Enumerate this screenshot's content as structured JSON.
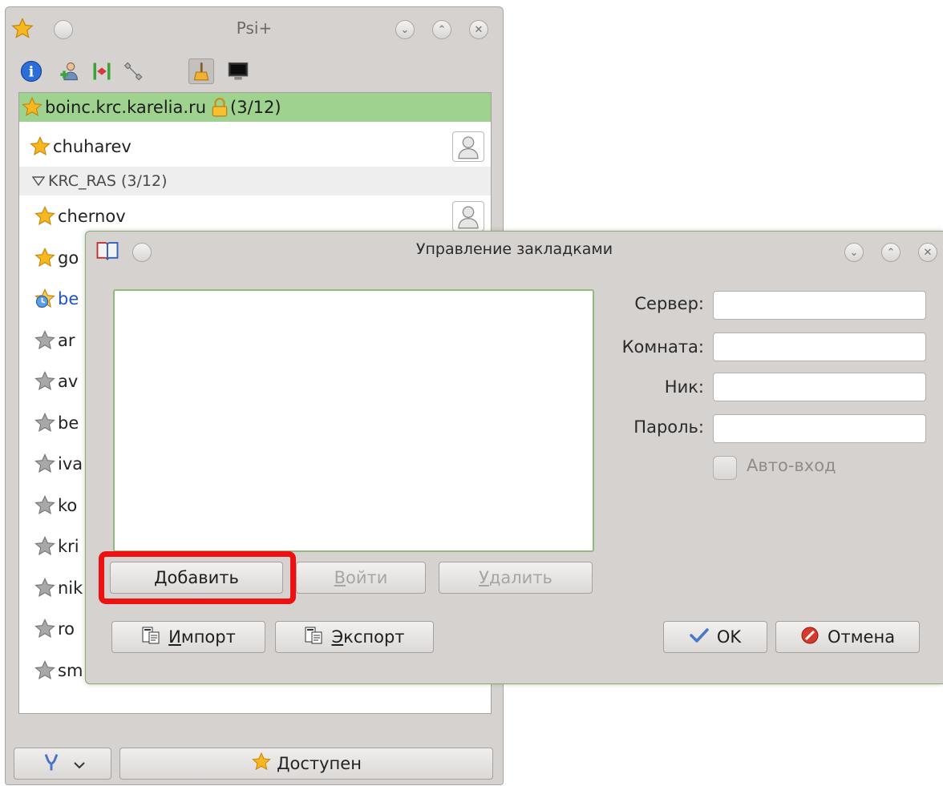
{
  "main_window": {
    "title": "Psi+",
    "toolbar_icons": [
      "info-icon",
      "add-contact-icon",
      "transfer-icon",
      "wrench-icon",
      "broom-icon",
      "console-icon"
    ],
    "account": {
      "name": "boinc.krc.karelia.ru",
      "count": "(3/12)"
    },
    "contacts_top": [
      {
        "name": "chuharev"
      }
    ],
    "group": {
      "name": "KRC_RAS (3/12)"
    },
    "contacts": [
      {
        "name": "chernov",
        "status": "online",
        "avatar": true
      },
      {
        "name": "go",
        "status": "online",
        "avatar": false
      },
      {
        "name": "be",
        "status": "away",
        "avatar": false
      },
      {
        "name": "ar",
        "status": "offline",
        "avatar": false
      },
      {
        "name": "av",
        "status": "offline",
        "avatar": false
      },
      {
        "name": "be",
        "status": "offline",
        "avatar": false
      },
      {
        "name": "iva",
        "status": "offline",
        "avatar": false
      },
      {
        "name": "ko",
        "status": "offline",
        "avatar": false
      },
      {
        "name": "kri",
        "status": "offline",
        "avatar": false
      },
      {
        "name": "nik",
        "status": "offline",
        "avatar": false
      },
      {
        "name": "ro",
        "status": "offline",
        "avatar": false
      },
      {
        "name": "sm",
        "status": "offline",
        "avatar": false
      }
    ],
    "status_button": "Доступен"
  },
  "dialog": {
    "title": "Управление закладками",
    "labels": {
      "server": "Сервер:",
      "room": "Комната:",
      "nick": "Ник:",
      "password": "Пароль:"
    },
    "inputs": {
      "server": "",
      "room": "",
      "nick": "",
      "password": ""
    },
    "autojoin": "Авто-вход",
    "buttons": {
      "add_first": "Д",
      "add_rest": "обавить",
      "join_first": "В",
      "join_rest": "ойти",
      "remove_first": "У",
      "remove_rest": "далить",
      "import_first": "И",
      "import_rest": "мпорт",
      "export_first": "Э",
      "export_rest": "кспорт",
      "ok": "OK",
      "cancel": "Отмена"
    }
  },
  "colors": {
    "account_row": "#9fd18f",
    "highlight": "#ee1111",
    "star": "#f6b820",
    "away_contact": "#1f52c7"
  }
}
